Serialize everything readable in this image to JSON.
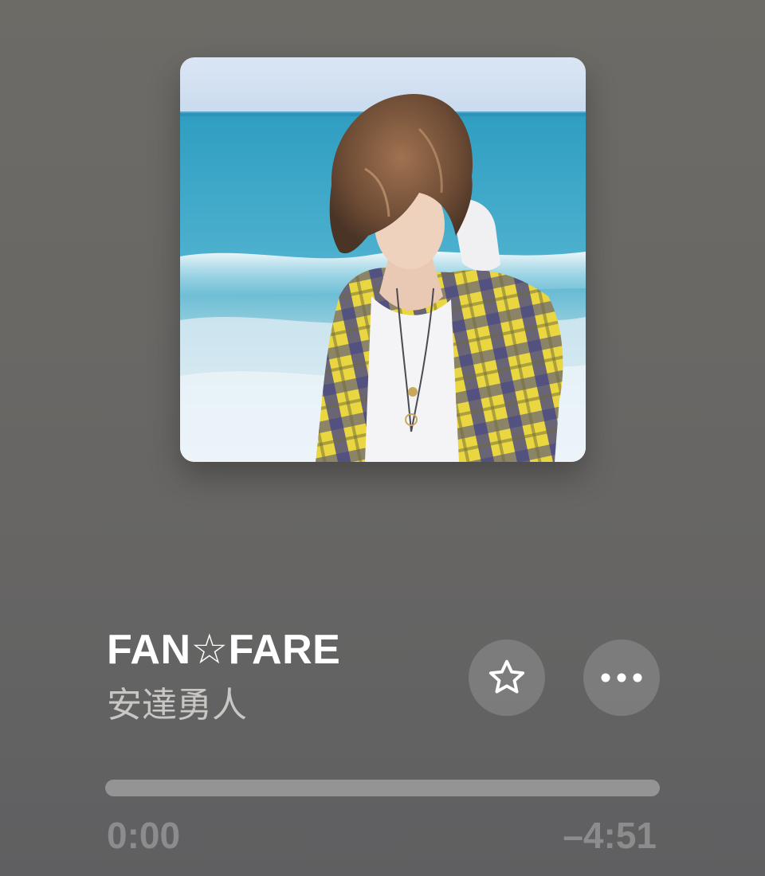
{
  "track": {
    "title": "FAN☆FARE",
    "artist": "安達勇人"
  },
  "artwork": {
    "icon": "album-artwork"
  },
  "controls": {
    "favorite_icon": "star-outline-icon",
    "more_icon": "ellipsis-icon"
  },
  "playback": {
    "elapsed": "0:00",
    "remaining": "–4:51",
    "progress_fraction": 0
  },
  "colors": {
    "background": "#6a6865",
    "title": "#ffffff",
    "artist": "#c9c7c3",
    "time": "#8c8c8e"
  }
}
